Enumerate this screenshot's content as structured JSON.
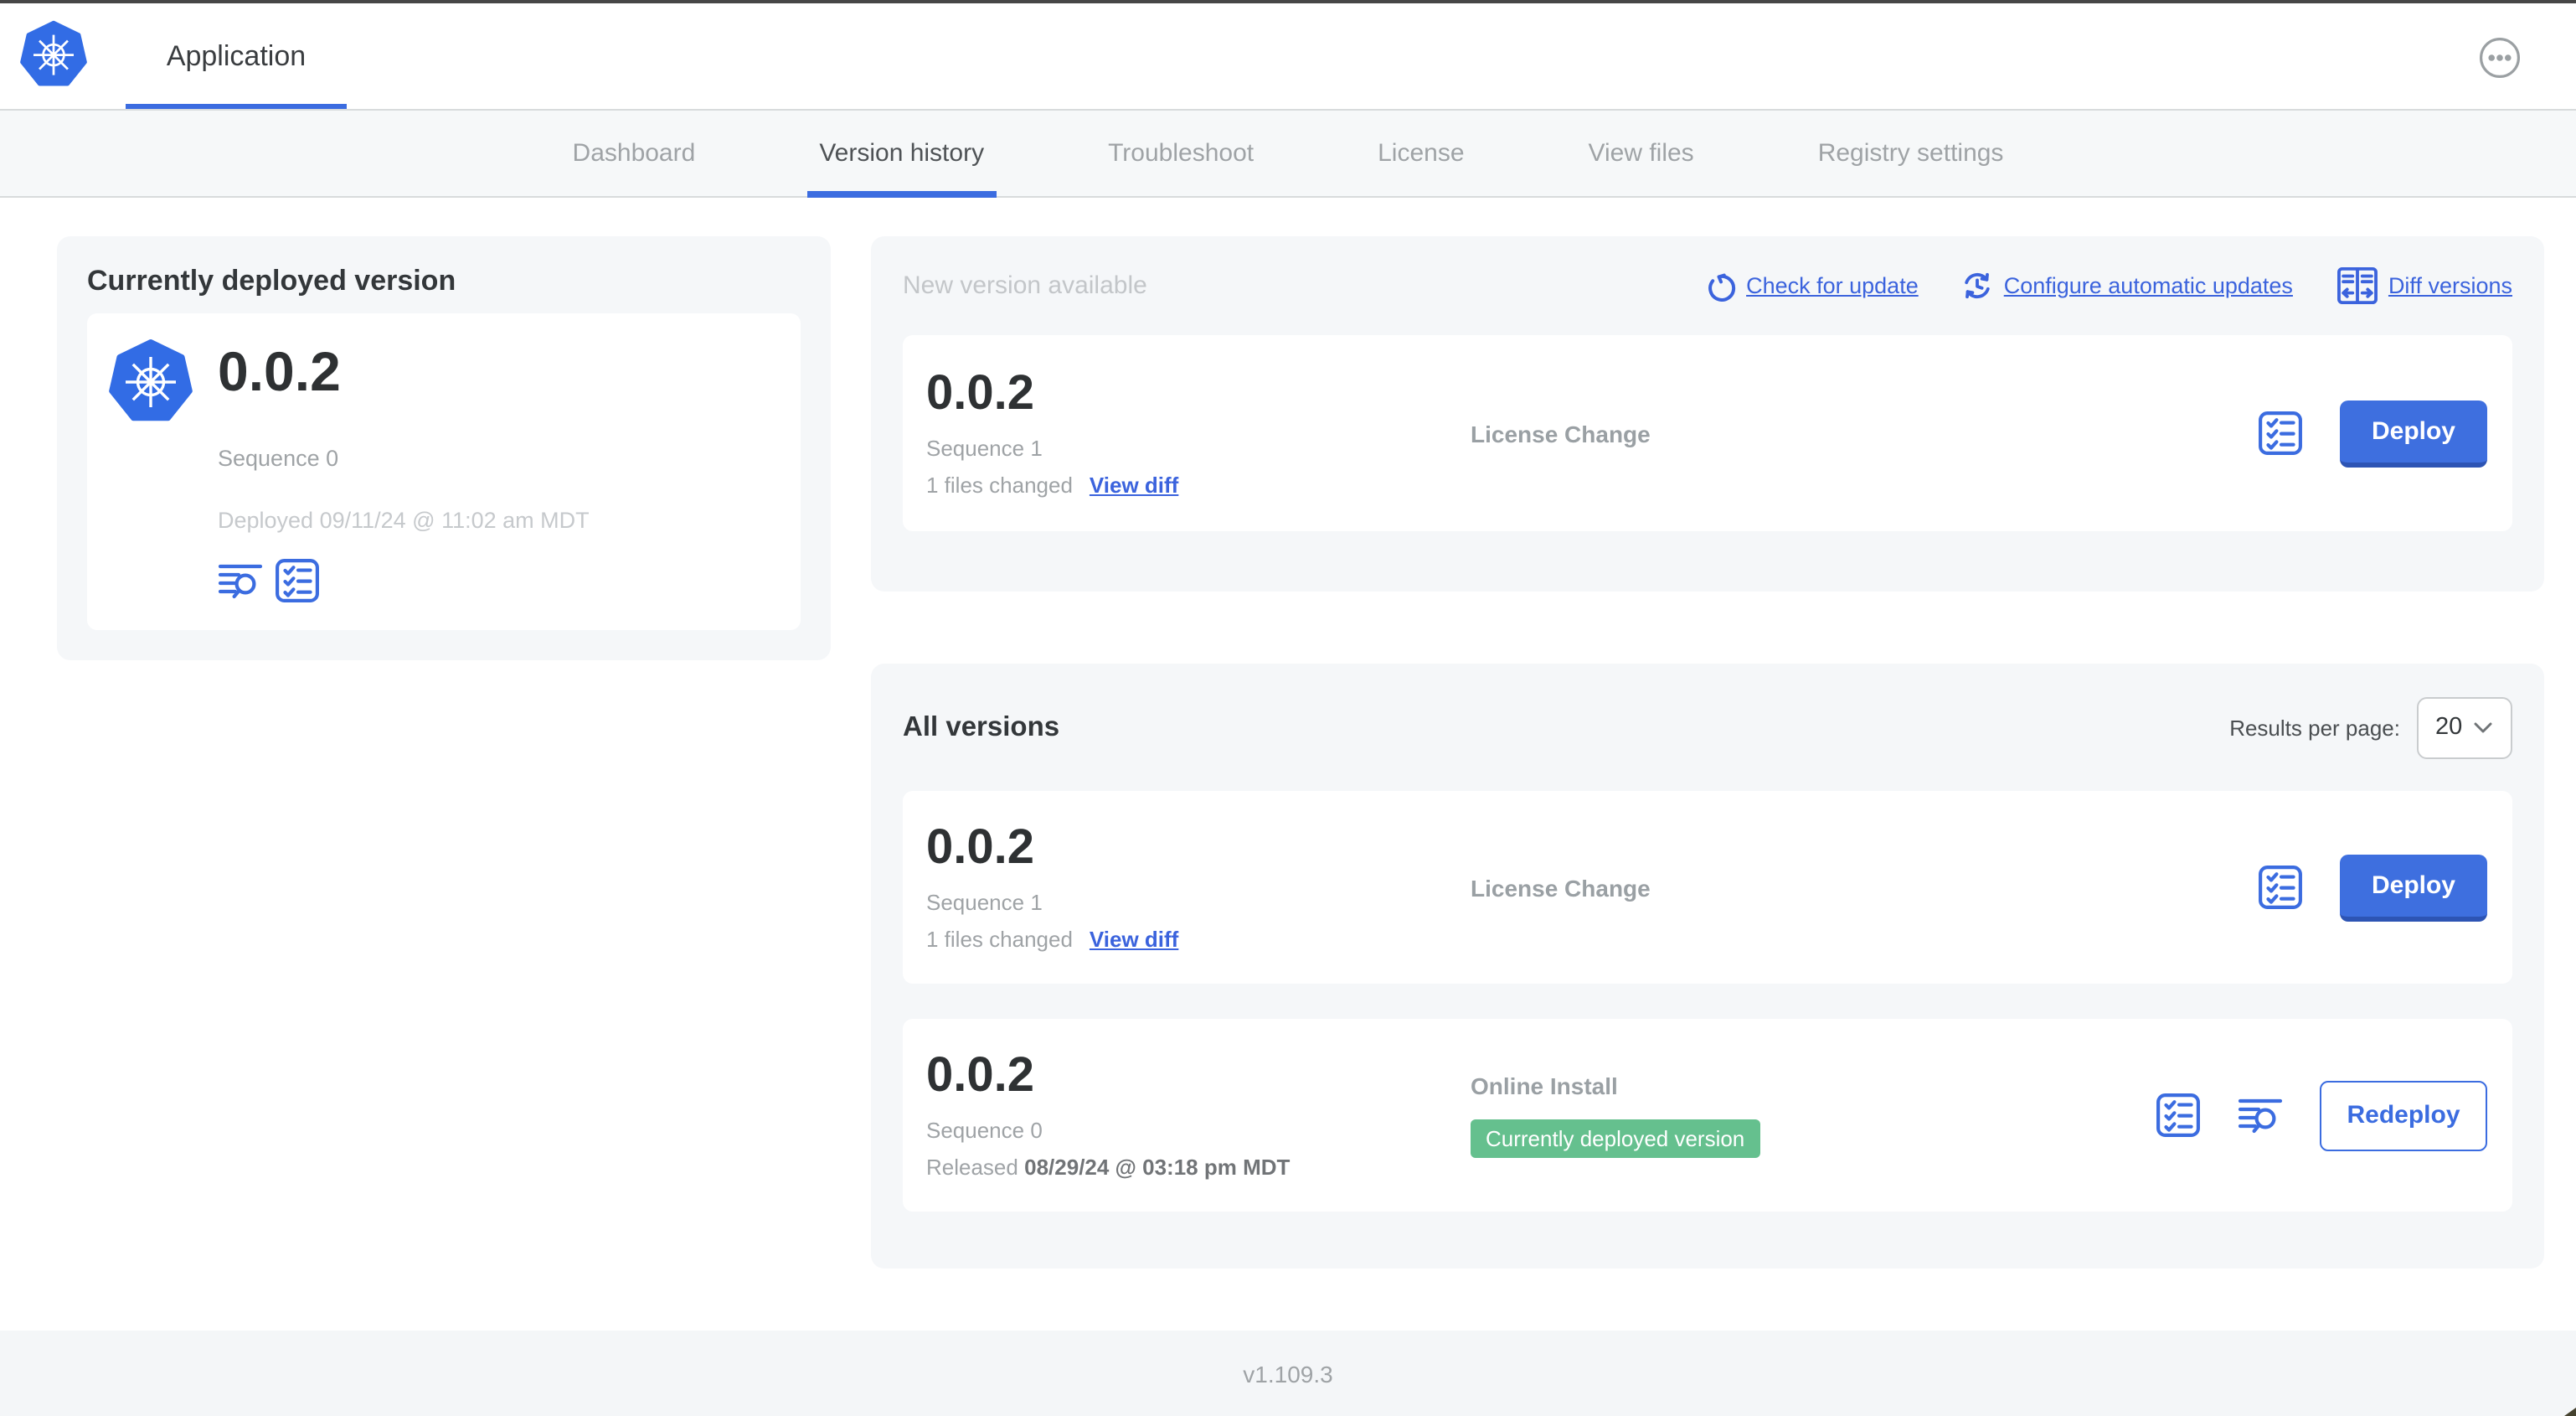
{
  "header": {
    "app_tab_label": "Application"
  },
  "nav": {
    "active_tab": "Version history",
    "tabs": [
      {
        "label": "Dashboard"
      },
      {
        "label": "Version history"
      },
      {
        "label": "Troubleshoot"
      },
      {
        "label": "License"
      },
      {
        "label": "View files"
      },
      {
        "label": "Registry settings"
      }
    ]
  },
  "current_version_panel": {
    "title": "Currently deployed version",
    "version": "0.0.2",
    "sequence": "Sequence 0",
    "deployed_at": "Deployed 09/11/24 @ 11:02 am MDT"
  },
  "new_version_panel": {
    "title": "New version available",
    "actions": {
      "check_for_update": "Check for update",
      "configure_automatic_updates": "Configure automatic updates",
      "diff_versions": "Diff versions"
    },
    "card": {
      "version": "0.0.2",
      "sequence": "Sequence 1",
      "files_changed": "1 files changed",
      "view_diff": "View diff",
      "source": "License Change",
      "deploy_label": "Deploy"
    }
  },
  "all_versions_panel": {
    "title": "All versions",
    "results_per_page_label": "Results per page:",
    "results_per_page_value": "20",
    "rows": [
      {
        "version": "0.0.2",
        "sequence": "Sequence 1",
        "files_changed": "1 files changed",
        "view_diff": "View diff",
        "source": "License Change",
        "action_label": "Deploy"
      },
      {
        "version": "0.0.2",
        "sequence": "Sequence 0",
        "released_prefix": "Released",
        "released_date": "08/29/24 @ 03:18 pm MDT",
        "source": "Online Install",
        "badge": "Currently deployed version",
        "action_label": "Redeploy"
      }
    ]
  },
  "footer": {
    "app_version": "v1.109.3"
  },
  "colors": {
    "accent_blue": "#3b6ce0",
    "link_blue": "#3b63dd",
    "deploy_button_blue": "#3e6fdf",
    "badge_green": "#65c08e",
    "kubernetes_blue": "#326ce5"
  }
}
